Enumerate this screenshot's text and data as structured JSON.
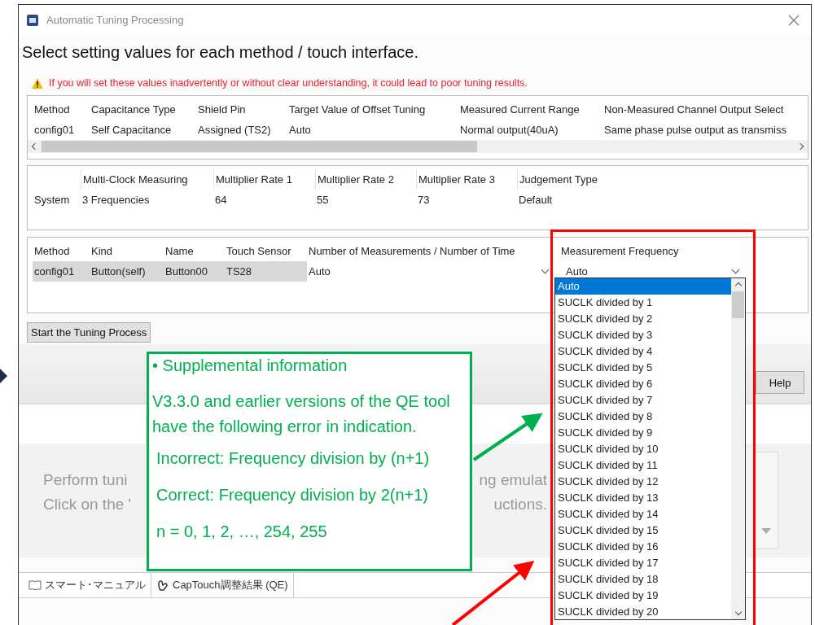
{
  "window": {
    "title": "Automatic Tuning Processing"
  },
  "heading": "Select setting values for each method / touch interface.",
  "warning": "If you will set these values inadvertently or without clear understanding, it could lead to poor tuning results.",
  "method_table": {
    "columns": [
      "Method",
      "Capacitance Type",
      "Shield Pin",
      "Target Value of Offset Tuning",
      "Measured Current Range",
      "Non-Measured Channel Output Select"
    ],
    "rows": [
      [
        "config01",
        "Self Capacitance",
        "Assigned (TS2)",
        "Auto",
        "Normal output(40uA)",
        "Same phase pulse output as transmiss"
      ]
    ]
  },
  "system_table": {
    "row_label": "System",
    "columns": [
      "Multi-Clock Measuring",
      "Multiplier Rate 1",
      "Multiplier Rate 2",
      "Multiplier Rate 3",
      "Judgement Type"
    ],
    "values": [
      "3 Frequencies",
      "64",
      "55",
      "73",
      "Default"
    ]
  },
  "touch_table": {
    "columns": [
      "Method",
      "Kind",
      "Name",
      "Touch Sensor",
      "Number of Measurements / Number of Time",
      "Measurement Frequency"
    ],
    "rows": [
      {
        "cells": [
          "config01",
          "Button(self)",
          "Button00",
          "TS28"
        ],
        "selected": true,
        "measurements": "Auto",
        "frequency": "Auto"
      }
    ]
  },
  "frequency_options": [
    {
      "label": "Auto",
      "selected": true
    },
    {
      "label": "SUCLK divided by 1",
      "selected": false
    },
    {
      "label": "SUCLK divided by 2",
      "selected": false
    },
    {
      "label": "SUCLK divided by 3",
      "selected": false
    },
    {
      "label": "SUCLK divided by 4",
      "selected": false
    },
    {
      "label": "SUCLK divided by 5",
      "selected": false
    },
    {
      "label": "SUCLK divided by 6",
      "selected": false
    },
    {
      "label": "SUCLK divided by 7",
      "selected": false
    },
    {
      "label": "SUCLK divided by 8",
      "selected": false
    },
    {
      "label": "SUCLK divided by 9",
      "selected": false
    },
    {
      "label": "SUCLK divided by 10",
      "selected": false
    },
    {
      "label": "SUCLK divided by 11",
      "selected": false
    },
    {
      "label": "SUCLK divided by 12",
      "selected": false
    },
    {
      "label": "SUCLK divided by 13",
      "selected": false
    },
    {
      "label": "SUCLK divided by 14",
      "selected": false
    },
    {
      "label": "SUCLK divided by 15",
      "selected": false
    },
    {
      "label": "SUCLK divided by 16",
      "selected": false
    },
    {
      "label": "SUCLK divided by 17",
      "selected": false
    },
    {
      "label": "SUCLK divided by 18",
      "selected": false
    },
    {
      "label": "SUCLK divided by 19",
      "selected": false
    },
    {
      "label": "SUCLK divided by 20",
      "selected": false
    }
  ],
  "start_button": "Start the Tuning Process",
  "help_button": "Help",
  "background_panel": {
    "lines": [
      {
        "left": "Perform tuni",
        "right": "ng emulat"
      },
      {
        "left": "Click on the '",
        "right": "uctions."
      }
    ]
  },
  "background_tabs": [
    {
      "label": "スマート･マニュアル"
    },
    {
      "label": "CapTouch調整結果 (QE)"
    }
  ],
  "callout": {
    "title": "• Supplemental information",
    "paragraphs": [
      "V3.3.0 and earlier versions of the QE tool have the following error in indication.",
      "Incorrect: Frequency division by (n+1)",
      "Correct: Frequency division by 2(n+1)",
      "n = 0, 1, 2, …, 254, 255"
    ]
  }
}
